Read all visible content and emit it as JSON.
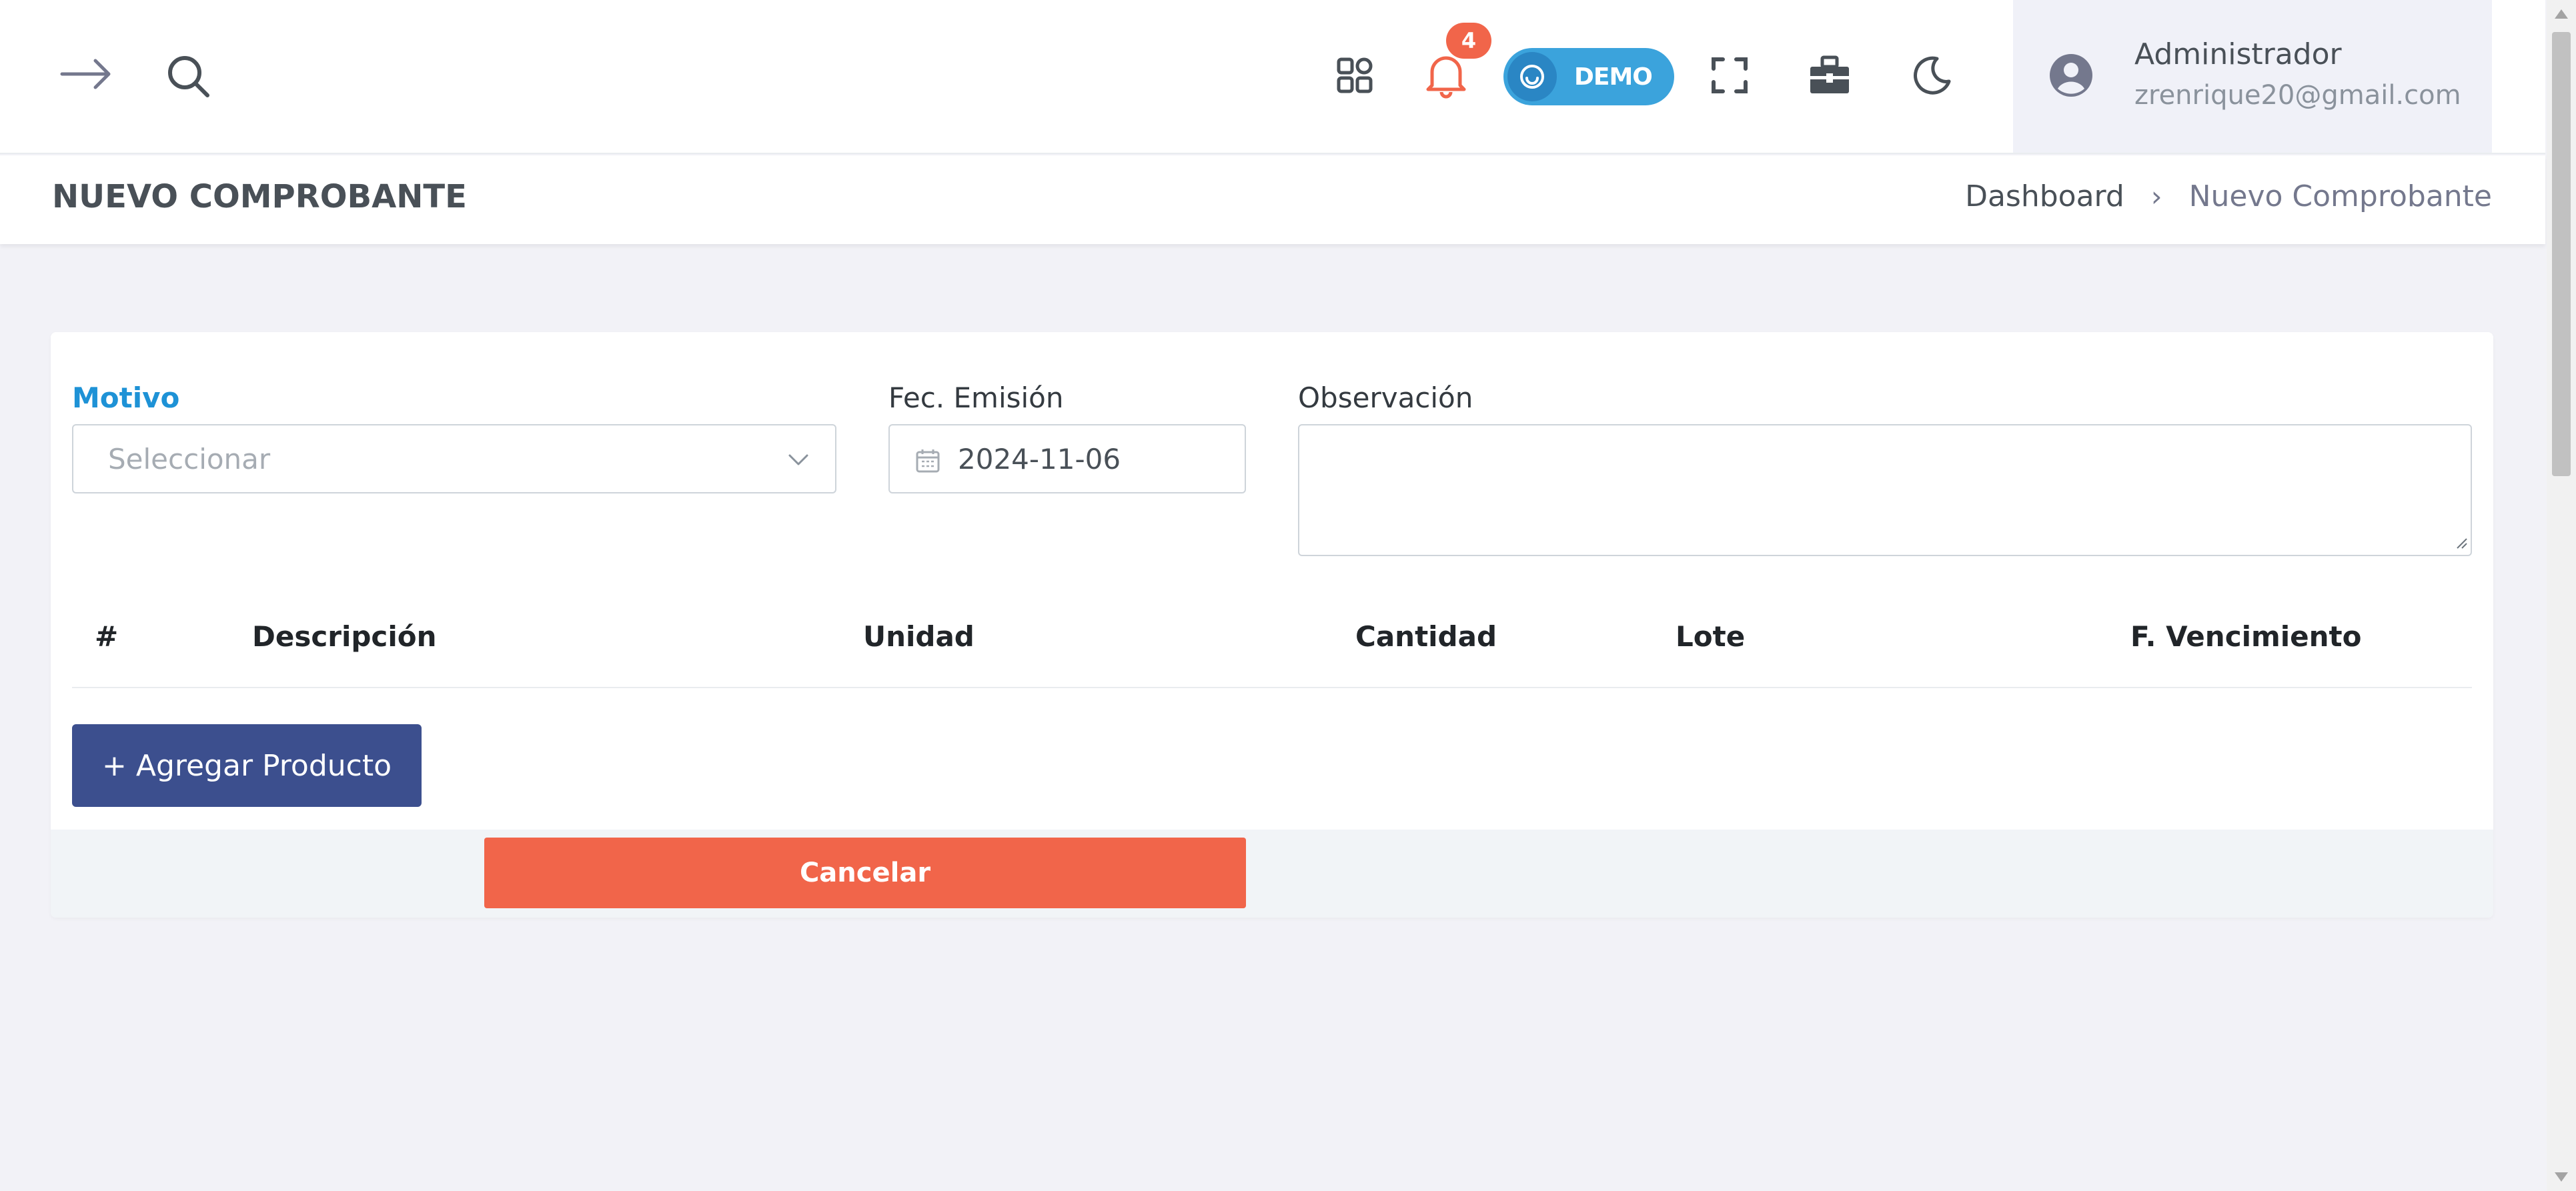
{
  "topbar": {
    "notification_count": "4",
    "demo_label": "DEMO",
    "user_name": "Administrador",
    "user_email": "zrenrique20@gmail.com",
    "icons": [
      "arrow-right-icon",
      "search-icon",
      "apps-grid-icon",
      "bell-icon",
      "fullscreen-icon",
      "toolbox-icon",
      "moon-icon",
      "user-avatar-icon"
    ]
  },
  "page": {
    "title": "NUEVO COMPROBANTE",
    "breadcrumb": [
      "Dashboard",
      "Nuevo Comprobante"
    ]
  },
  "form": {
    "motivo_label": "Motivo",
    "motivo_placeholder": "Seleccionar",
    "fecha_label": "Fec. Emisión",
    "fecha_value": "2024-11-06",
    "observacion_label": "Observación",
    "observacion_value": ""
  },
  "table": {
    "columns": [
      "#",
      "Descripción",
      "Unidad",
      "Cantidad",
      "Lote",
      "F. Vencimiento"
    ],
    "rows": []
  },
  "buttons": {
    "add_product": "+ Agregar Producto",
    "cancel": "Cancelar"
  },
  "colors": {
    "accent_blue": "#1e92d6",
    "primary_button": "#3c4f8e",
    "danger_button": "#f1654a",
    "demo_pill": "#3ba3dc"
  }
}
